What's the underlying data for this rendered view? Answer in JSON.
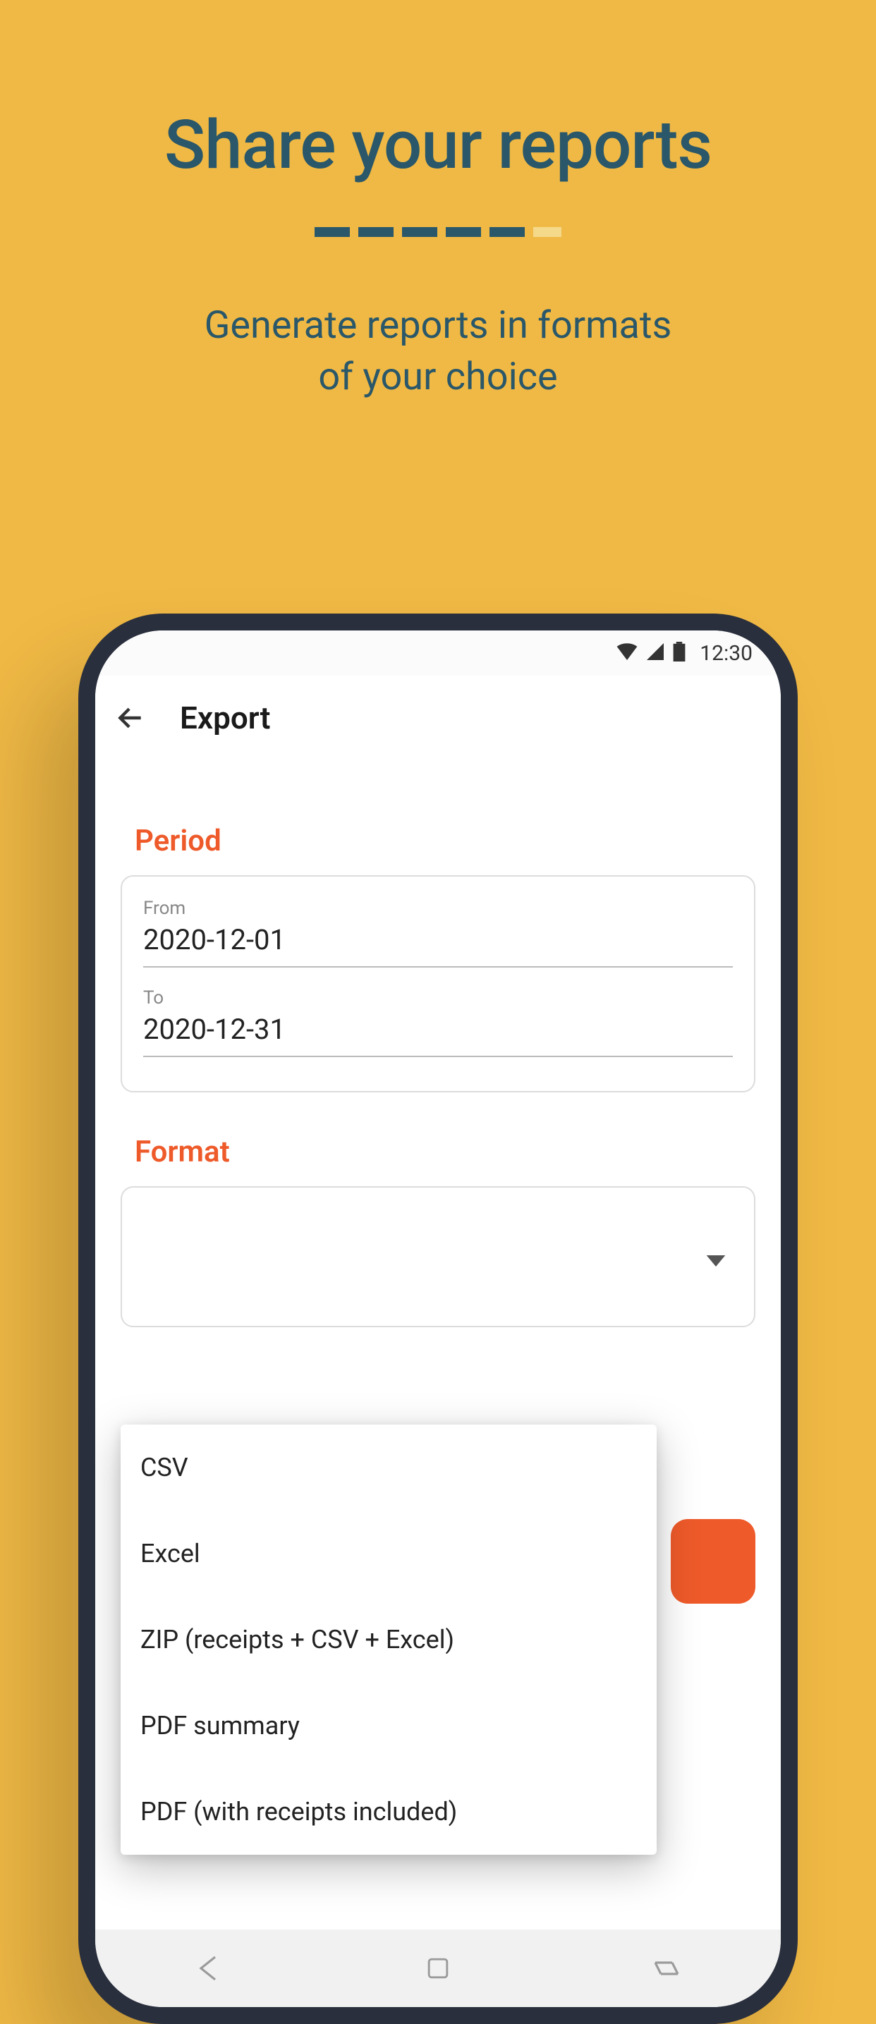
{
  "promo": {
    "title": "Share your reports",
    "subtitle_line1": "Generate reports in formats",
    "subtitle_line2": "of your choice"
  },
  "status": {
    "time": "12:30"
  },
  "appbar": {
    "title": "Export"
  },
  "sections": {
    "period_label": "Period",
    "format_label": "Format"
  },
  "period": {
    "from_label": "From",
    "from_value": "2020-12-01",
    "to_label": "To",
    "to_value": "2020-12-31"
  },
  "format_options": {
    "0": "CSV",
    "1": "Excel",
    "2": "ZIP (receipts + CSV + Excel)",
    "3": "PDF summary",
    "4": "PDF (with receipts included)"
  }
}
